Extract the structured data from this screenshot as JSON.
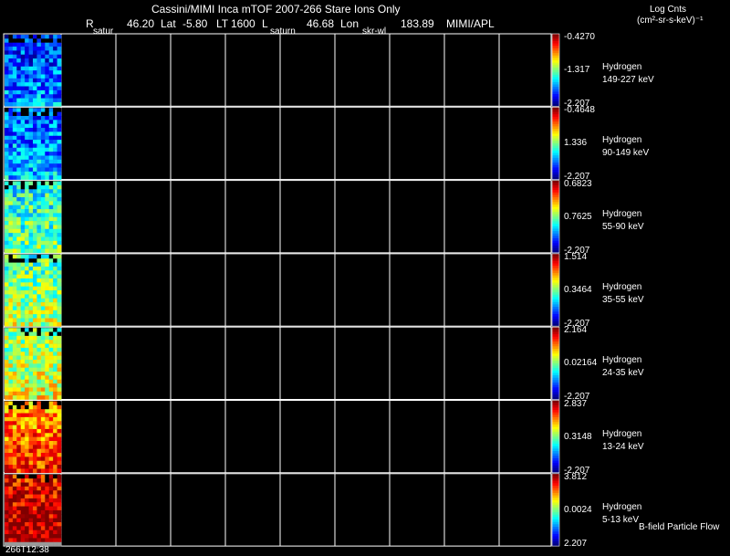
{
  "header": {
    "title": "Cassini/MIMI Inca mTOF  2007-266   Stare    Ions Only",
    "r_label": "R",
    "r_value": "46.20",
    "lat_label": "Lat",
    "lat_value": "-5.80",
    "lt_label": "LT",
    "lt_value": "1600",
    "l_label": "L",
    "l_value": "46.68",
    "lon_label": "Lon",
    "lon_value": "183.89",
    "institution": "MIMI/APL",
    "marker_left": "satur",
    "marker_mid": "saturn",
    "marker_right": "skr-wl",
    "units_line1": "Log Cnts",
    "units_line2": "(cm²-sr-s-keV)⁻¹"
  },
  "footer": {
    "time_label": "266T12:38",
    "bfield_label": "B-field Particle Flow"
  },
  "chart_data": {
    "type": "heatmap",
    "panels": [
      {
        "species": "Hydrogen",
        "energy": "149-227 keV",
        "max": "-0.4270",
        "mid": "-1.317",
        "min": "-2.207",
        "level": 0.15
      },
      {
        "species": "Hydrogen",
        "energy": "90-149 keV",
        "max": "-0.4648",
        "mid": "1.336",
        "min": "-2.207",
        "level": 0.2
      },
      {
        "species": "Hydrogen",
        "energy": "55-90 keV",
        "max": "0.6823",
        "mid": "0.7625",
        "min": "-2.207",
        "level": 0.38
      },
      {
        "species": "Hydrogen",
        "energy": "35-55 keV",
        "max": "1.514",
        "mid": "0.3464",
        "min": "-2.207",
        "level": 0.45
      },
      {
        "species": "Hydrogen",
        "energy": "24-35 keV",
        "max": "2.164",
        "mid": "0.02164",
        "min": "-2.207",
        "level": 0.5
      },
      {
        "species": "Hydrogen",
        "energy": "13-24 keV",
        "max": "2.837",
        "mid": "0.3148",
        "min": "-2.207",
        "level": 0.72
      },
      {
        "species": "Hydrogen",
        "energy": "5-13 keV",
        "max": "3.812",
        "mid": "0.0024",
        "min": "2.207",
        "level": 0.88
      }
    ],
    "grid": true
  }
}
